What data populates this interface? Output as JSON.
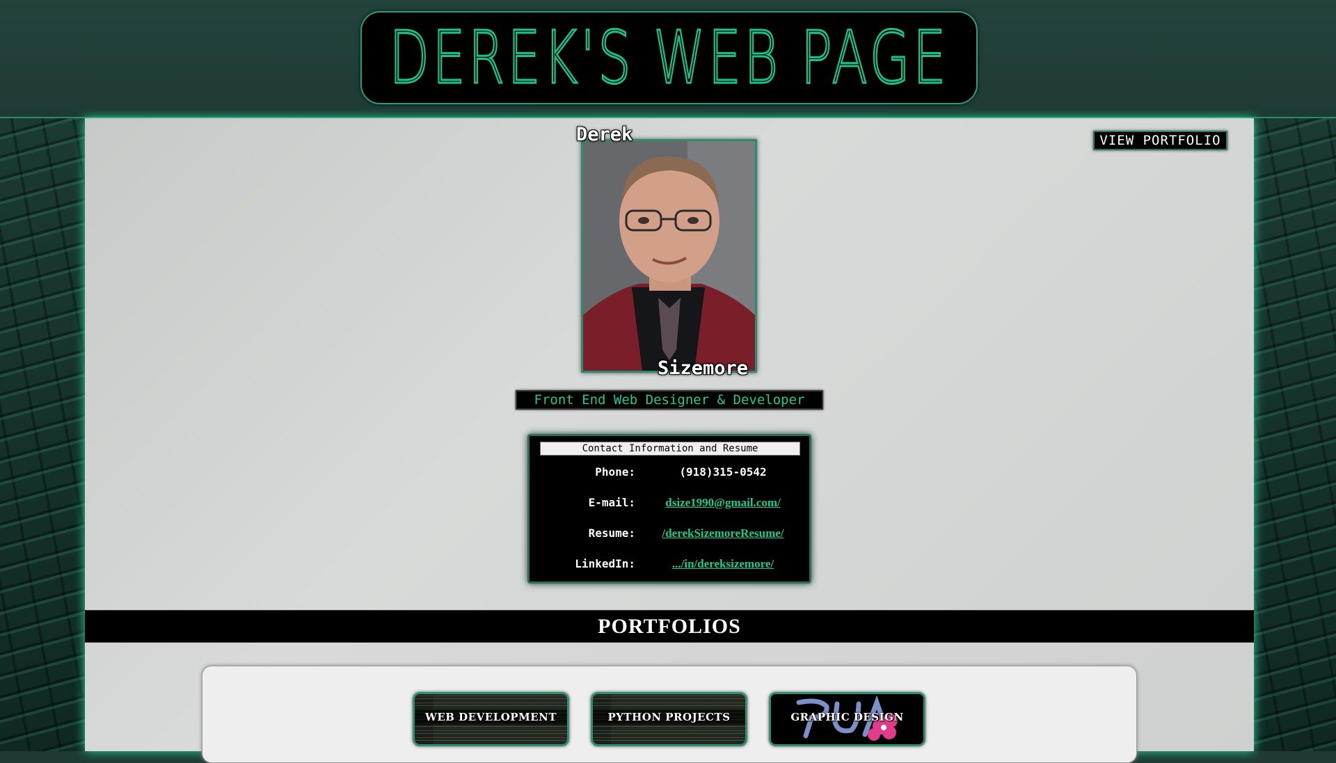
{
  "header": {
    "title": "DEREK'S WEB PAGE"
  },
  "nav": {
    "view_portfolio": "VIEW PORTFOLIO"
  },
  "profile": {
    "first_name": "Derek",
    "last_name": "Sizemore",
    "job_title": "Front End Web Designer & Developer"
  },
  "contact": {
    "header": "Contact Information and Resume",
    "rows": [
      {
        "label": "Phone:",
        "value": "(918)315-0542"
      },
      {
        "label": "E-mail:",
        "value": "dsize1990@gmail.com/"
      },
      {
        "label": "Resume:",
        "value": "/derekSizemoreResume/"
      },
      {
        "label": "LinkedIn:",
        "value": ".../in/dereksizemore/"
      }
    ]
  },
  "portfolios": {
    "title": "PORTFOLIOS",
    "cards": [
      {
        "label": "WEB DEVELOPMENT"
      },
      {
        "label": "PYTHON PROJECTS"
      },
      {
        "label": "GRAPHIC DESIGN"
      }
    ]
  },
  "colors": {
    "accent": "#19c48b",
    "header_bg": "#24433d",
    "panel_bg": "#d0d2d1"
  }
}
